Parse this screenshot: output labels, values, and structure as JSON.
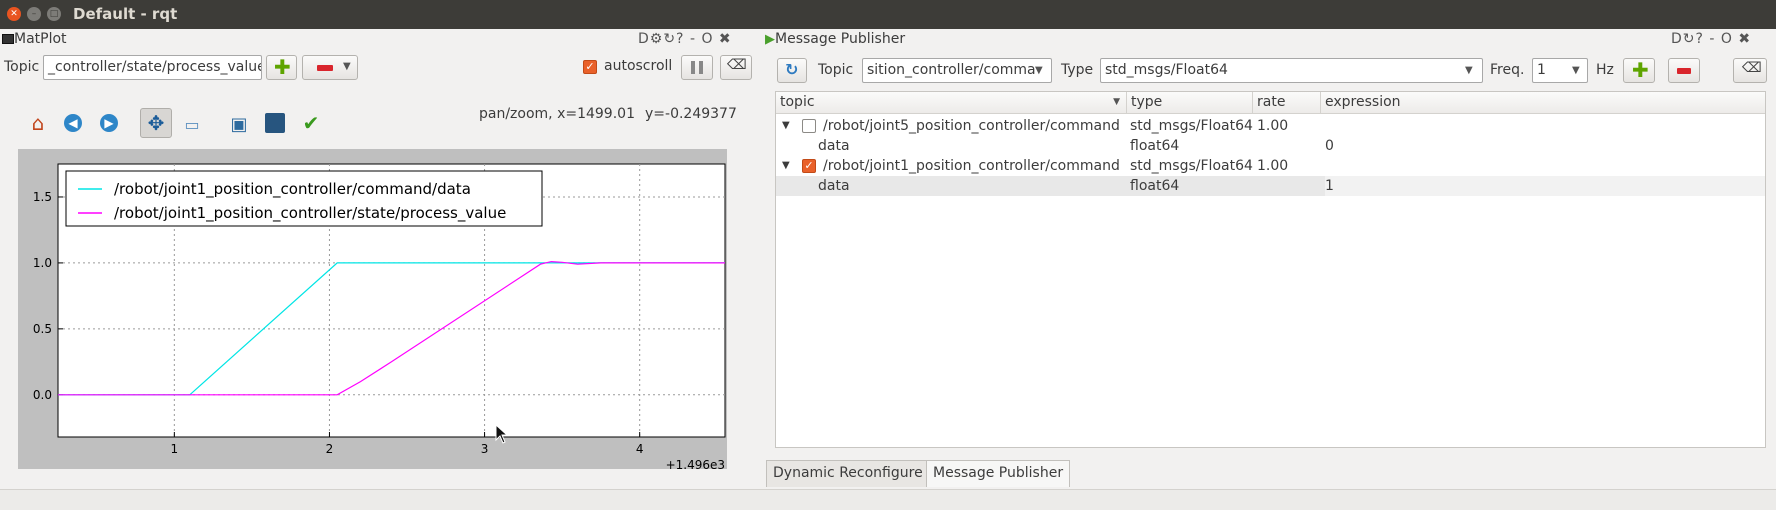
{
  "window": {
    "title": "Default - rqt"
  },
  "matplot": {
    "dock_title": "MatPlot",
    "dock_buttons": "D⚙↻? - O ✖",
    "topic_label": "Topic",
    "topic_value": "_controller/state/process_value",
    "autoscroll_label": "autoscroll",
    "autoscroll_checked": true,
    "coord_readout_x": "pan/zoom, x=1499.01",
    "coord_readout_y": "y=-0.249377",
    "toolbar": [
      "home-icon",
      "back-icon",
      "forward-icon",
      "pan-icon",
      "zoom-icon",
      "subplots-icon",
      "save-icon",
      "edit-curves-icon"
    ]
  },
  "chart_data": {
    "type": "line",
    "xlabel": "",
    "ylabel": "",
    "x_offset_label": "+1.496e3",
    "xlim": [
      0.25,
      4.55
    ],
    "ylim": [
      -0.32,
      1.75
    ],
    "xticks": [
      "1",
      "2",
      "3",
      "4"
    ],
    "yticks": [
      "0.0",
      "0.5",
      "1.0",
      "1.5"
    ],
    "grid": true,
    "legend_position": "top-left",
    "series": [
      {
        "name": "/robot/joint1_position_controller/command/data",
        "color": "#00e5e5",
        "x": [
          0.25,
          1.1,
          2.05,
          4.55
        ],
        "y": [
          0,
          0,
          1,
          1
        ]
      },
      {
        "name": "/robot/joint1_position_controller/state/process_value",
        "color": "#ff00ff",
        "x": [
          0.25,
          2.05,
          2.2,
          2.4,
          3.36,
          3.43,
          3.5,
          3.6,
          3.75,
          4.0,
          4.55
        ],
        "y": [
          0,
          0,
          0.1,
          0.25,
          0.99,
          1.01,
          1.005,
          0.99,
          1.0,
          1.0,
          1.0
        ]
      }
    ]
  },
  "publisher": {
    "dock_title": "Message Publisher",
    "dock_buttons": "D↻? - O ✖",
    "topic_label": "Topic",
    "topic_value": "sition_controller/comma",
    "type_label": "Type",
    "type_value": "std_msgs/Float64",
    "freq_label": "Freq.",
    "freq_value": "1",
    "hz_label": "Hz",
    "columns": [
      "topic",
      "type",
      "rate",
      "expression"
    ],
    "rows": [
      {
        "expander": "▼",
        "checked": false,
        "topic": "/robot/joint5_position_controller/command",
        "type": "std_msgs/Float64",
        "rate": "1.00",
        "expression": ""
      },
      {
        "expander": "",
        "checked": null,
        "topic": "data",
        "type": "float64",
        "rate": "",
        "expression": "0"
      },
      {
        "expander": "▼",
        "checked": true,
        "topic": "/robot/joint1_position_controller/command",
        "type": "std_msgs/Float64",
        "rate": "1.00",
        "expression": ""
      },
      {
        "expander": "",
        "checked": null,
        "topic": "data",
        "type": "float64",
        "rate": "",
        "expression": "1"
      }
    ]
  },
  "tabs": [
    "Dynamic Reconfigure",
    "Message Publisher"
  ]
}
